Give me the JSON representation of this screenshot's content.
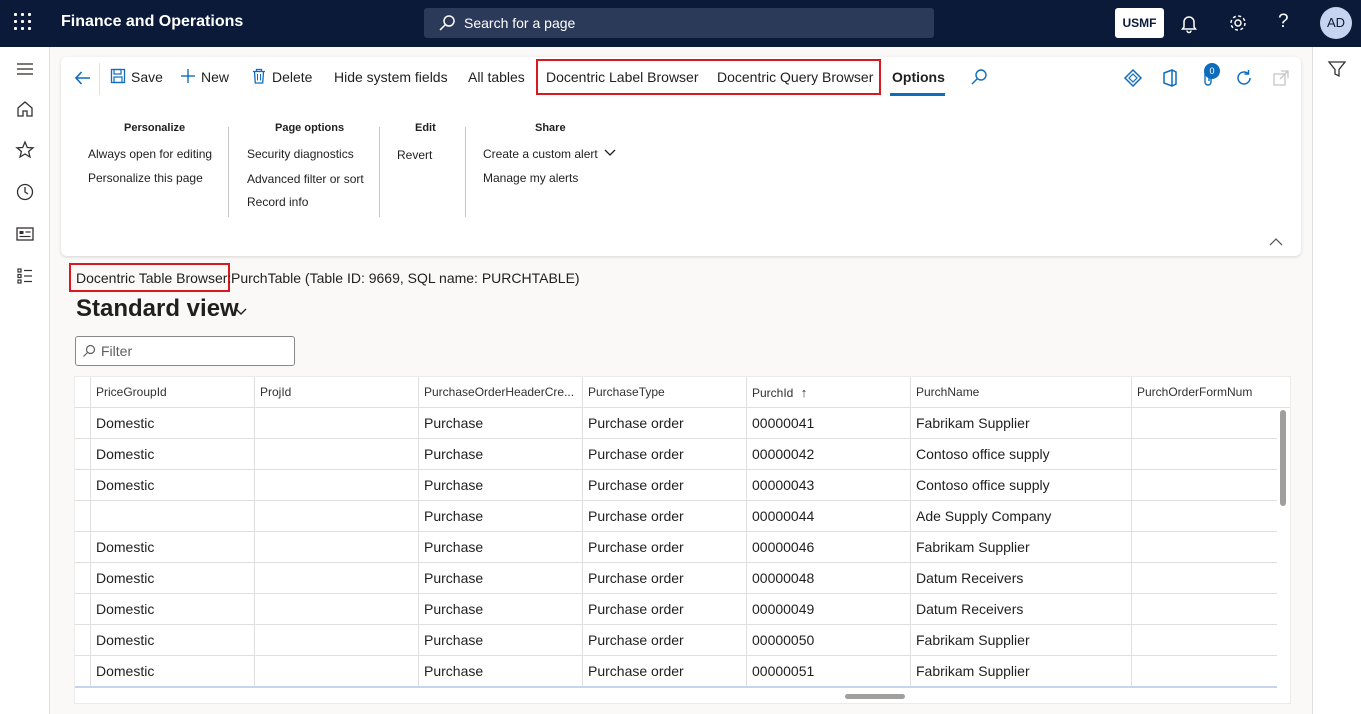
{
  "header": {
    "app_title": "Finance and Operations",
    "search_text": "Search for a page",
    "company": "USMF",
    "avatar_initials": "AD",
    "help_glyph": "?"
  },
  "action_pane": {
    "buttons": {
      "save": "Save",
      "new": "New",
      "delete": "Delete",
      "hide_system_fields": "Hide system fields",
      "all_tables": "All tables",
      "label_browser": "Docentric Label Browser",
      "query_browser": "Docentric Query Browser",
      "options": "Options"
    },
    "attachments_count": "0",
    "groups": {
      "personalize": {
        "title": "Personalize",
        "items": [
          "Always open for editing",
          "Personalize this page"
        ]
      },
      "page_options": {
        "title": "Page options",
        "items": [
          "Security diagnostics",
          "Advanced filter or sort",
          "Record info"
        ]
      },
      "edit": {
        "title": "Edit",
        "items": [
          "Revert"
        ]
      },
      "share": {
        "title": "Share",
        "items": [
          "Create a custom alert",
          "Manage my alerts"
        ]
      }
    }
  },
  "content": {
    "table_browser_label": "Docentric Table Browser:",
    "table_info": "PurchTable (Table ID: 9669, SQL name: PURCHTABLE)",
    "view_title": "Standard view",
    "filter_placeholder": "Filter"
  },
  "grid": {
    "columns": [
      "PriceGroupId",
      "ProjId",
      "PurchaseOrderHeaderCre...",
      "PurchaseType",
      "PurchId",
      "PurchName",
      "PurchOrderFormNum"
    ],
    "sort_indicator": "↑",
    "rows": [
      [
        "Domestic",
        "",
        "Purchase",
        "Purchase order",
        "00000041",
        "Fabrikam Supplier",
        ""
      ],
      [
        "Domestic",
        "",
        "Purchase",
        "Purchase order",
        "00000042",
        "Contoso office supply",
        ""
      ],
      [
        "Domestic",
        "",
        "Purchase",
        "Purchase order",
        "00000043",
        "Contoso office supply",
        ""
      ],
      [
        "",
        "",
        "Purchase",
        "Purchase order",
        "00000044",
        "Ade Supply Company",
        ""
      ],
      [
        "Domestic",
        "",
        "Purchase",
        "Purchase order",
        "00000046",
        "Fabrikam Supplier",
        ""
      ],
      [
        "Domestic",
        "",
        "Purchase",
        "Purchase order",
        "00000048",
        "Datum Receivers",
        ""
      ],
      [
        "Domestic",
        "",
        "Purchase",
        "Purchase order",
        "00000049",
        "Datum Receivers",
        ""
      ],
      [
        "Domestic",
        "",
        "Purchase",
        "Purchase order",
        "00000050",
        "Fabrikam Supplier",
        ""
      ],
      [
        "Domestic",
        "",
        "Purchase",
        "Purchase order",
        "00000051",
        "Fabrikam Supplier",
        ""
      ]
    ]
  },
  "colors": {
    "nav_bar": "#0b1a38",
    "accent": "#0f6cbd",
    "highlight_box": "#d71920"
  }
}
